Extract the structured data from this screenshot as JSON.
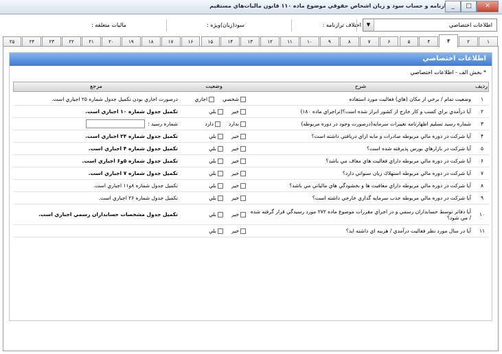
{
  "window": {
    "title": "اظهارنامه ، ترازنامه و حساب سود و زيان اشخاص حقوقي موضوع ماده ۱۱۰ قانون ماليات‌هاي مستقيم",
    "min": "0",
    "max": "1",
    "close": "r"
  },
  "toprow": {
    "combo_value": "اطلاعات اختصاصي",
    "combo_arrow": "▼",
    "ekhtelaf_label": "اختلاف ترازنامه :",
    "sood_label": "سود(زيان)ويژه :",
    "maliat_label": "ماليات متعلقه :"
  },
  "tabs": [
    "۱",
    "۲",
    "۳",
    "۴",
    "۵",
    "۶",
    "۷",
    "۸",
    "۹",
    "۱۰",
    "۱۱",
    "۱۲",
    "۱۳",
    "۱۴",
    "۱۵",
    "۱۶",
    "۱۷",
    "۱۸",
    "۱۹",
    "۲۰",
    "۲۱",
    "۲۲",
    "۲۳",
    "۲۴",
    "۲۵"
  ],
  "active_tab": 2,
  "panel": {
    "header": "اطلاعات اختصاصي",
    "section": "* بخش الف - اطلاعات اختصاصي"
  },
  "grid": {
    "columns": {
      "num": "رديف",
      "desc": "شرح",
      "status": "وضعيت",
      "ref": "مرجع"
    },
    "rows": [
      {
        "num": "۱",
        "desc": "وضعيت تمام / برخي از مكان (هاي) فعاليت مورد استفاده",
        "opts": [
          "شخصي",
          "اجاري"
        ],
        "ref": "درصورت اجاري بودن تكميل جدول شماره ۲۵ اجباري است.",
        "ref_bold": false
      },
      {
        "num": "۲",
        "desc": "آيا درآمدي براي كسب و كار خارج از كشور ابراز شده است؟(تراجراي ماده ۱۸۰)",
        "opts": [
          "خير",
          "بلي"
        ],
        "ref": "تكميل جدول شماره ۱۰ اجباري است.",
        "ref_bold": true
      },
      {
        "num": "۳",
        "desc": "شماره رسيد تسليم اظهارنامه تغييرات سرمايه(درصورت وجود در دوره مربوطه)",
        "opts": [
          "ندارد",
          "دارد"
        ],
        "ref": "شماره رسيد :",
        "ref_bold": false,
        "has_input": true
      },
      {
        "num": "۴",
        "desc": "آيا شركت در دوره مالي مربوطه صادرات و مابه ازاي دريافتي داشته است؟",
        "opts": [
          "خير",
          "بلي"
        ],
        "ref": "تكميل جدول شماره ۲۴ اجباري است.",
        "ref_bold": true
      },
      {
        "num": "۵",
        "desc": "آيا شركت در بازارهاي بورس پذيرفته شده است؟",
        "opts": [
          "خير",
          "بلي"
        ],
        "ref": "تكميل جدول شماره ۴ اجباري است.",
        "ref_bold": true
      },
      {
        "num": "۶",
        "desc": "آيا شركت در دوره مالي مربوطه داراي فعاليت هاي معاف مي باشد؟",
        "opts": [
          "خير",
          "بلي"
        ],
        "ref": "تكميل جدول شماره ۵و۶ اجباري است.",
        "ref_bold": true
      },
      {
        "num": "۷",
        "desc": "آيا شركت در دوره مالي مربوطه استهلاك زيان سنواتي دارد؟",
        "opts": [
          "خير",
          "بلي"
        ],
        "ref": "تكميل جدول شماره ۷ اجباري است.",
        "ref_bold": true
      },
      {
        "num": "۸",
        "desc": "آيا شركت در دوره مالي مربوطه داراي معافيت ها و بخشودگي هاي مالياتي مي باشد؟",
        "opts": [
          "خير",
          "بلي"
        ],
        "ref": "تكميل جدول شماره ۸و۱۱ اجباري است.",
        "ref_bold": false
      },
      {
        "num": "۹",
        "desc": "آيا شركت در دوره مالي مربوطه جذب سرمايه گذاري خارجي داشته است؟",
        "opts": [
          "خير",
          "بلي"
        ],
        "ref": "تكميل جدول شماره ۲۶ اجباري است.",
        "ref_bold": false
      },
      {
        "num": "۱۰",
        "desc": "آيا دفاتر توسط حسابداران رسمي و در اجراي مقررات موضوع ماده ۲۷۲ مورد رسيدگي قرار گرفته شده / مي شود؟",
        "opts": [
          "خير",
          "بلي"
        ],
        "ref": "تكميل جدول مشخصات حسابداران رسمي اجباري است.",
        "ref_bold": true
      },
      {
        "num": "۱۱",
        "desc": "آيا در سال مورد نظر فعاليت درآمدي / هزينه اي داشته ايد؟",
        "opts": [
          "خير",
          "بلي"
        ],
        "ref": "",
        "ref_bold": false
      }
    ]
  }
}
